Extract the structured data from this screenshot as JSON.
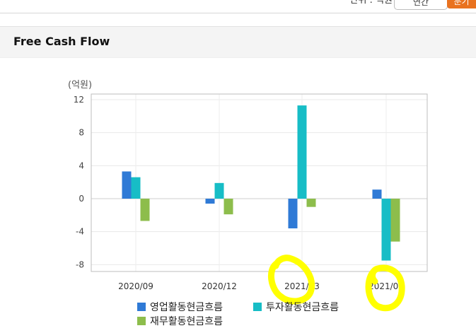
{
  "header": {
    "unit_text": "단위 : 억원",
    "button_a_label": "연간",
    "button_b_label": "분기"
  },
  "panel": {
    "title": "Free Cash Flow"
  },
  "chart_data": {
    "type": "bar",
    "title": "",
    "ylabel": "(억원)",
    "xlabel": "",
    "categories": [
      "2020/09",
      "2020/12",
      "2021/03",
      "2021/06"
    ],
    "yticks": [
      12,
      8,
      4,
      0,
      -4,
      -8
    ],
    "ylim": [
      -9,
      12
    ],
    "grid": true,
    "legend_position": "bottom",
    "series": [
      {
        "name": "영업활동현금흐름",
        "color": "#2f7ad6",
        "values": [
          3.3,
          -0.6,
          -3.6,
          1.1
        ]
      },
      {
        "name": "투자활동현금흐름",
        "color": "#17bdc6",
        "values": [
          2.6,
          1.9,
          11.3,
          -7.5
        ]
      },
      {
        "name": "재무활동현금흐름",
        "color": "#8dbd4c",
        "values": [
          -2.7,
          -1.9,
          -1.0,
          -5.2
        ]
      }
    ]
  },
  "annotations": {
    "highlight_color": "#ffff00"
  }
}
